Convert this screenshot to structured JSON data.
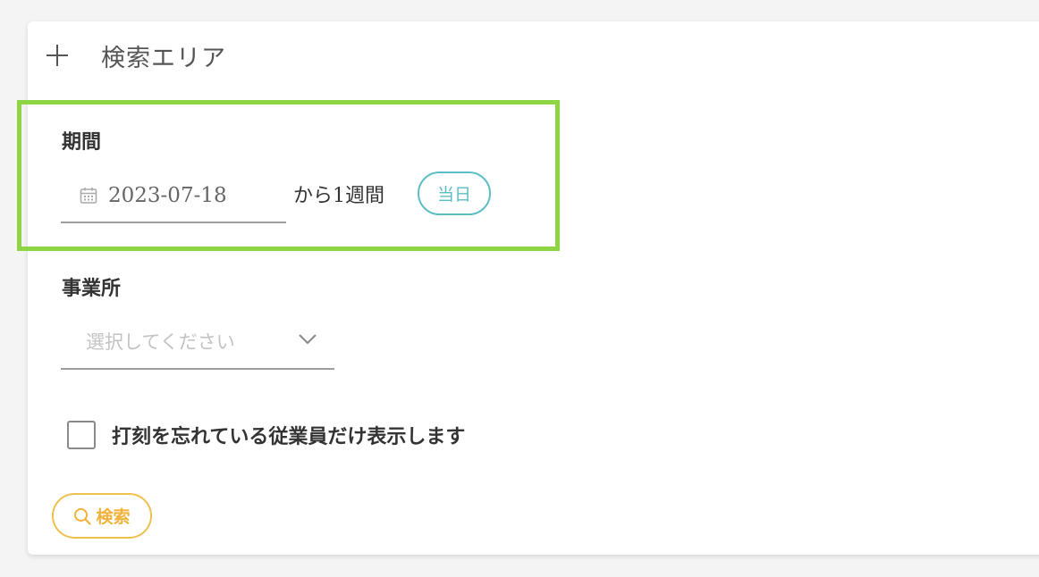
{
  "search_area": {
    "title": "検索エリア",
    "toggle_icon": "plus-icon"
  },
  "period": {
    "label": "期間",
    "date_icon": "calendar-icon",
    "date_value": "2023-07-18",
    "range_text": "から1週間",
    "today_button": "当日"
  },
  "office": {
    "label": "事業所",
    "placeholder": "選択してください",
    "dropdown_icon": "chevron-down-icon"
  },
  "filter": {
    "checked": false,
    "label": "打刻を忘れている従業員だけ表示します"
  },
  "actions": {
    "search_icon": "search-icon",
    "search_label": "検索"
  },
  "colors": {
    "highlight": "#8ed544",
    "today_accent": "#5bbec6",
    "search_accent": "#f0c04e"
  }
}
